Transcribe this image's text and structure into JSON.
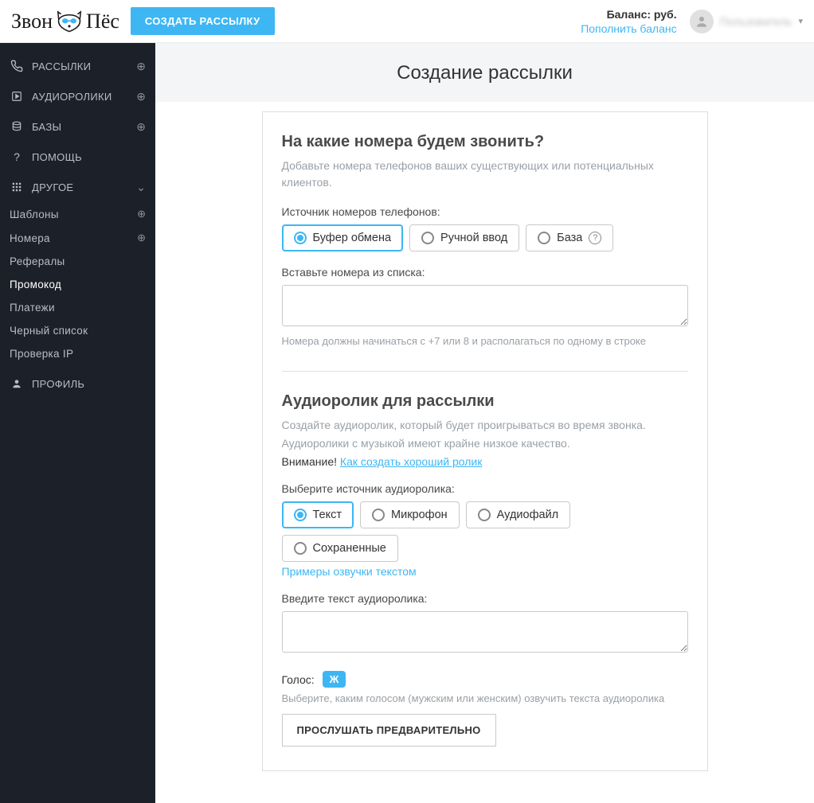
{
  "header": {
    "logo_left": "Звон",
    "logo_right": "Пёс",
    "create_btn": "СОЗДАТЬ РАССЫЛКУ",
    "balance_label": "Баланс: ",
    "balance_value": "  ",
    "balance_currency": "руб.",
    "top_up": "Пополнить баланс",
    "username": "Пользователь"
  },
  "sidebar": {
    "items": [
      {
        "label": "РАССЫЛКИ",
        "icon": "phone",
        "right": "plus"
      },
      {
        "label": "АУДИОРОЛИКИ",
        "icon": "play",
        "right": "plus"
      },
      {
        "label": "БАЗЫ",
        "icon": "db",
        "right": "plus"
      },
      {
        "label": "ПОМОЩЬ",
        "icon": "help",
        "right": ""
      },
      {
        "label": "ДРУГОЕ",
        "icon": "grid",
        "right": "chevron"
      }
    ],
    "subs": [
      {
        "label": "Шаблоны",
        "plus": true
      },
      {
        "label": "Номера",
        "plus": true
      },
      {
        "label": "Рефералы"
      },
      {
        "label": "Промокод",
        "active": true
      },
      {
        "label": "Платежи"
      },
      {
        "label": "Черный список"
      },
      {
        "label": "Проверка IP"
      }
    ],
    "profile": "ПРОФИЛЬ"
  },
  "page": {
    "title": "Создание рассылки",
    "s1": {
      "title": "На какие номера будем звонить?",
      "desc": "Добавьте номера телефонов ваших существующих или потенциальных клиентов.",
      "source_label": "Источник номеров телефонов:",
      "opts": [
        "Буфер обмена",
        "Ручной ввод",
        "База"
      ],
      "paste_label": "Вставьте номера из списка:",
      "hint": "Номера должны начинаться с +7 или 8 и располагаться по одному в строке"
    },
    "s2": {
      "title": "Аудиоролик для рассылки",
      "desc1": "Создайте аудиоролик, который будет проигрываться во время звонка.",
      "desc2": "Аудиоролики с музыкой имеют крайне низкое качество.",
      "warn_pre": "Внимание! ",
      "warn_link": "Как создать хороший ролик",
      "src_label": "Выберите источник аудиоролика:",
      "opts": [
        "Текст",
        "Микрофон",
        "Аудиофайл",
        "Сохраненные"
      ],
      "examples": "Примеры озвучки текстом",
      "text_label": "Введите текст аудиоролика:",
      "voice_label": "Голос:",
      "voice_value": "Ж",
      "voice_hint": "Выберите, каким голосом (мужским или женским) озвучить текста аудиоролика",
      "preview_btn": "ПРОСЛУШАТЬ ПРЕДВАРИТЕЛЬНО"
    }
  }
}
